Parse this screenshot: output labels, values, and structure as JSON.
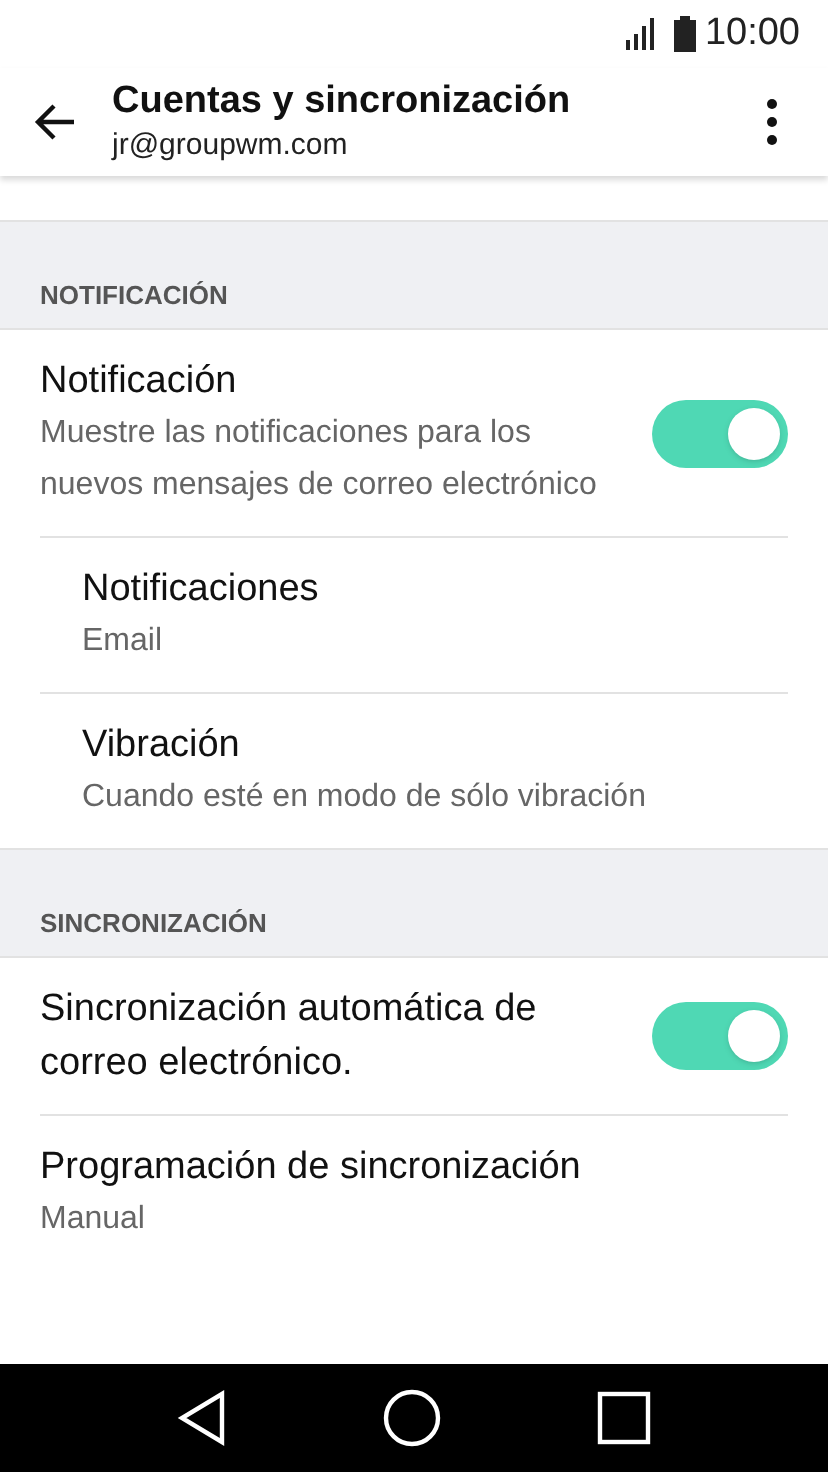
{
  "status_bar": {
    "time": "10:00"
  },
  "app_bar": {
    "title": "Cuentas y sincronización",
    "subtitle": "jr@groupwm.com"
  },
  "sections": [
    {
      "header": "NOTIFICACIÓN",
      "items": [
        {
          "kind": "switch",
          "title": "Notificación",
          "subtitle": "Muestre las notificaciones para los nuevos mensajes de correo electrónico",
          "on": true
        },
        {
          "kind": "sub",
          "title": "Notificaciones",
          "subtitle": "Email"
        },
        {
          "kind": "sub",
          "title": "Vibración",
          "subtitle": "Cuando esté en modo de sólo vibración"
        }
      ]
    },
    {
      "header": "SINCRONIZACIÓN",
      "items": [
        {
          "kind": "switch",
          "title": "Sincronización automática de correo electrónico.",
          "on": true
        },
        {
          "kind": "plain",
          "title": "Programación de sincronización",
          "subtitle": "Manual"
        }
      ]
    }
  ]
}
